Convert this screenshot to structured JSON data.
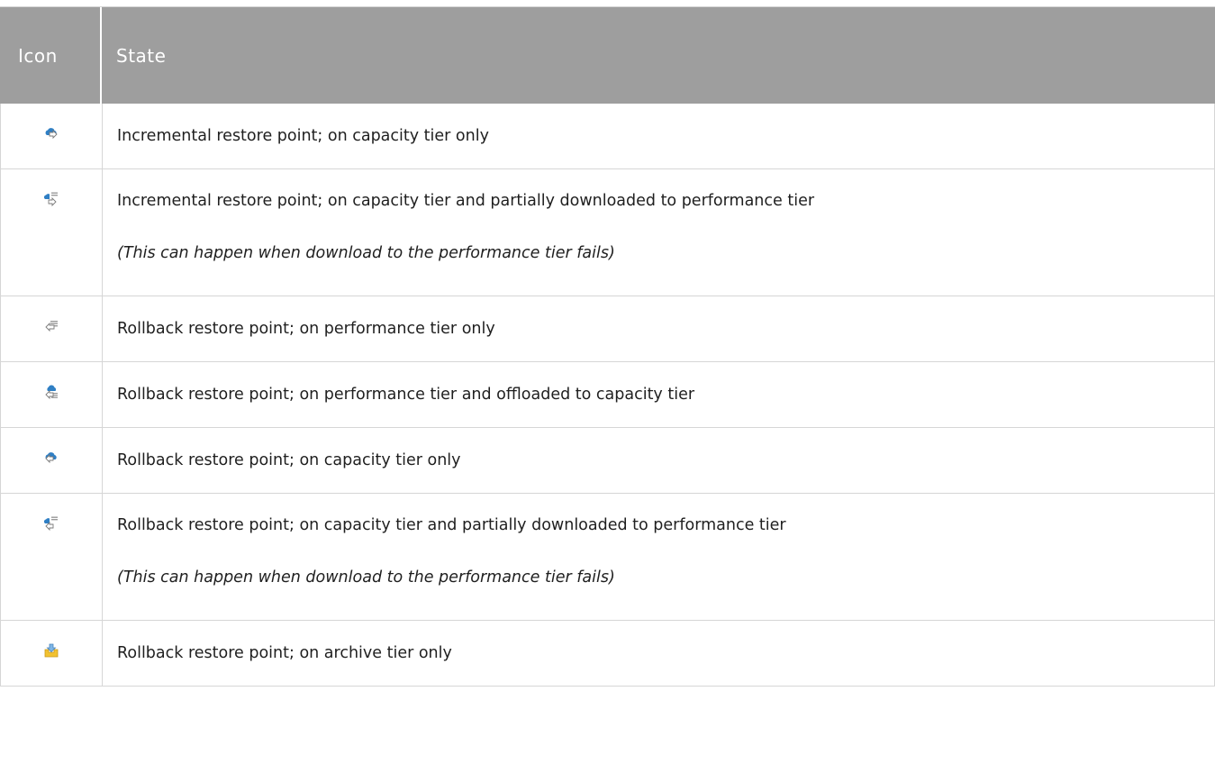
{
  "header": {
    "icon_col": "Icon",
    "state_col": "State"
  },
  "rows": [
    {
      "icon": "cloud-incremental-icon",
      "state": "Incremental restore point; on capacity tier only"
    },
    {
      "icon": "cloud-incremental-partial-icon",
      "state": "Incremental restore point; on capacity tier and partially downloaded to performance tier",
      "note": "(This can happen when download to the performance tier fails)"
    },
    {
      "icon": "rollback-icon",
      "state": "Rollback restore point; on performance tier only"
    },
    {
      "icon": "rollback-offloaded-icon",
      "state": "Rollback restore point; on performance tier and offloaded to capacity tier"
    },
    {
      "icon": "cloud-rollback-icon",
      "state": "Rollback restore point; on capacity tier only"
    },
    {
      "icon": "cloud-rollback-partial-icon",
      "state": "Rollback restore point; on capacity tier and partially downloaded to performance tier",
      "note": "(This can happen when download to the performance tier fails)"
    },
    {
      "icon": "archive-rollback-icon",
      "state": "Rollback restore point; on archive tier only"
    }
  ],
  "colors": {
    "header_bg": "#9e9e9e",
    "cloud_blue": "#2f7fc4",
    "archive_yellow": "#f2c230"
  }
}
